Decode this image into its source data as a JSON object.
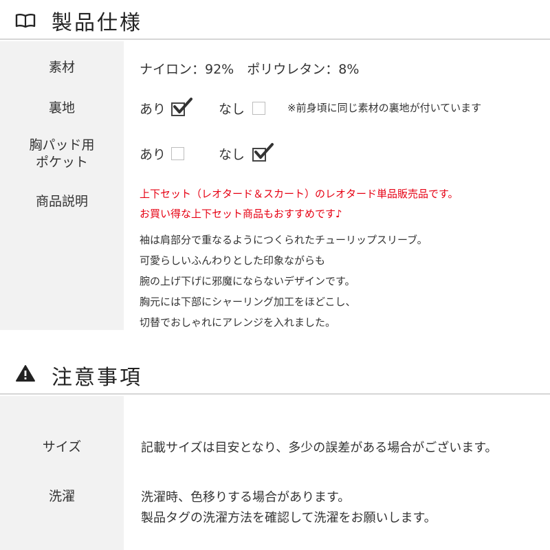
{
  "spec": {
    "title": "製品仕様",
    "material": {
      "label": "素材",
      "value": "ナイロン：92%　ポリウレタン：8%"
    },
    "lining": {
      "label": "裏地",
      "yes": "あり",
      "no": "なし",
      "yes_checked": true,
      "no_checked": false,
      "note": "※前身頃に同じ素材の裏地が付いています"
    },
    "pad_pocket": {
      "label_line1": "胸パッド用",
      "label_line2": "ポケット",
      "yes": "あり",
      "no": "なし",
      "yes_checked": false,
      "no_checked": true
    },
    "description": {
      "label": "商品説明",
      "highlight": [
        "上下セット（レオタード＆スカート）のレオタード単品販売品です。",
        "お買い得な上下セット商品もおすすめです♪"
      ],
      "lines": [
        "袖は肩部分で重なるようにつくられたチューリップスリーブ。",
        "可愛らしいふんわりとした印象ながらも",
        "腕の上げ下げに邪魔にならないデザインです。",
        "胸元には下部にシャーリング加工をほどこし、",
        "切替でおしゃれにアレンジを入れました。"
      ]
    }
  },
  "notes": {
    "title": "注意事項",
    "size": {
      "label": "サイズ",
      "text": "記載サイズは目安となり、多少の誤差がある場合がございます。"
    },
    "wash": {
      "label": "洗濯",
      "line1": "洗濯時、色移りする場合があります。",
      "line2": "製品タグの洗濯方法を確認して洗濯をお願いします。"
    }
  },
  "colors": {
    "accent_red": "#e60012",
    "label_bg": "#f2f2f2",
    "rule": "#d6d6d6"
  },
  "icons": {
    "spec": "open-book-icon",
    "notes": "warning-icon"
  }
}
